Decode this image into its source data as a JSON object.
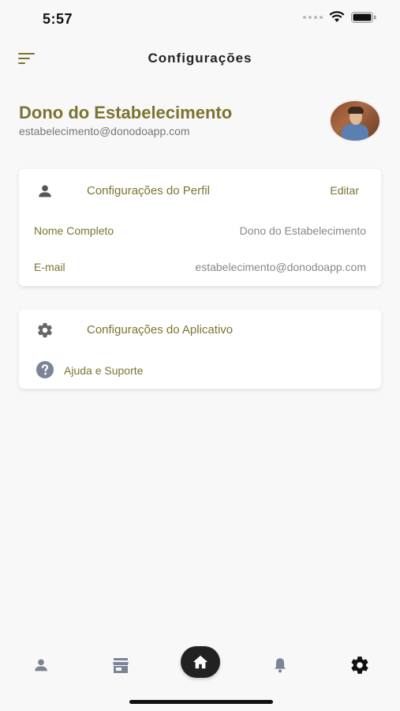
{
  "status": {
    "time": "5:57"
  },
  "header": {
    "title": "Configurações"
  },
  "profile": {
    "name": "Dono do Estabelecimento",
    "email": "estabelecimento@donodoapp.com"
  },
  "profile_settings": {
    "title": "Configurações do Perfil",
    "edit_label": "Editar",
    "fields": [
      {
        "label": "Nome Completo",
        "value": "Dono do Estabelecimento"
      },
      {
        "label": "E-mail",
        "value": "estabelecimento@donodoapp.com"
      }
    ]
  },
  "app_settings": {
    "title": "Configurações do Aplicativo",
    "help_label": "Ajuda e Suporte"
  },
  "bottom_nav": {
    "items": [
      "person-icon",
      "store-icon",
      "home-icon",
      "bell-icon",
      "gear-icon"
    ],
    "active": "gear-icon"
  },
  "colors": {
    "accent": "#7d7330",
    "background": "#f8f8f8",
    "text_muted": "#888888"
  }
}
